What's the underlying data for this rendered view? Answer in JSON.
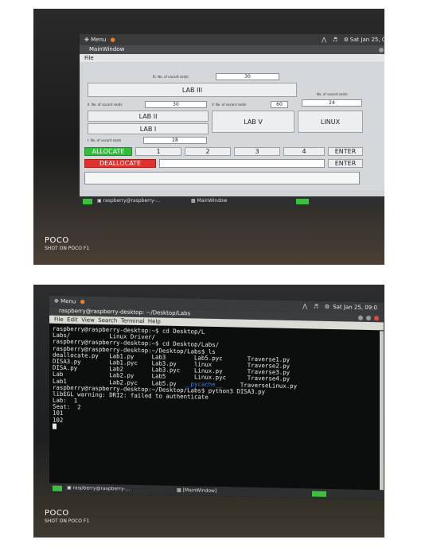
{
  "photo1": {
    "menu_label": "Menu",
    "clock": "Sat Jan 25, 09:05",
    "window_title": "MainWindow",
    "menubar": [
      "File"
    ],
    "labs": {
      "lab3": {
        "seats_label": "III. No. of vacant seats",
        "seats_value": "30",
        "button": "LAB III"
      },
      "lab2": {
        "seats_label": "II. No. of vacant seats",
        "seats_value": "30",
        "button": "LAB II"
      },
      "lab5": {
        "seats_label": "V. No. of vacant seats",
        "seats_value": "60",
        "button": "LAB V"
      },
      "linux": {
        "seats_label": "No. of vacant seats",
        "seats_value": "24",
        "button": "LINUX"
      },
      "lab1": {
        "seats_label": "I. No. of vacant seats",
        "seats_value": "28",
        "button": "LAB I"
      }
    },
    "allocate_button": "ALLOCATE",
    "deallocate_button": "DEALLOCATE",
    "number_buttons": [
      "1",
      "2",
      "3",
      "4"
    ],
    "enter_buttons": [
      "ENTER",
      "ENTER"
    ],
    "taskbar": {
      "terminal_item": "raspberry@raspberry-...",
      "window_item": "MainWindow"
    },
    "colors": {
      "allocate": "#2fbf3a",
      "deallocate": "#e0322d"
    }
  },
  "photo2": {
    "menu_label": "Menu",
    "clock": "Sat Jan 25, 09:0",
    "window_title": "raspberry@raspberry-desktop: ~/Desktop/Labs",
    "menubar": [
      "File",
      "Edit",
      "View",
      "Search",
      "Terminal",
      "Help"
    ],
    "terminal_lines": [
      "raspberry@raspberry-desktop:~$ cd Desktop/L",
      "Labs/           Linux Driver/",
      "raspberry@raspberry-desktop:~$ cd Desktop/Labs/",
      "raspberry@raspberry-desktop:~/Desktop/Labs$ ls",
      "deallocate.py   Lab1.py     Lab3        Lab5.pyc       Traverse1.py",
      "DISA3.py        Lab1.pyc    Lab3.py     linux          Traverse2.py",
      "DISA.py         Lab2        Lab3.pyc    Linux.py       Traverse3.py",
      "Lab             Lab2.py     Lab5        Linux.pyc      Traverse4.py",
      "Lab1            Lab2.pyc    Lab5.py",
      "raspberry@raspberry-desktop:~/Desktop/Labs$ python3 DISA3.py",
      "libEGL warning: DRI2: failed to authenticate",
      "Lab:  1",
      "Seat:  2",
      "101",
      "102"
    ],
    "ls_last_row_extra": {
      "pycache": "__pycache__",
      "tail": "TraverseLinux.py"
    },
    "taskbar": {
      "terminal_item": "raspberry@raspberry-...",
      "window_item": "[MainWindow]"
    }
  },
  "captions": [
    {
      "brand": "POCO",
      "shot": "SHOT ON POCO F1"
    },
    {
      "brand": "POCO",
      "shot": "SHOT ON POCO F1"
    }
  ]
}
